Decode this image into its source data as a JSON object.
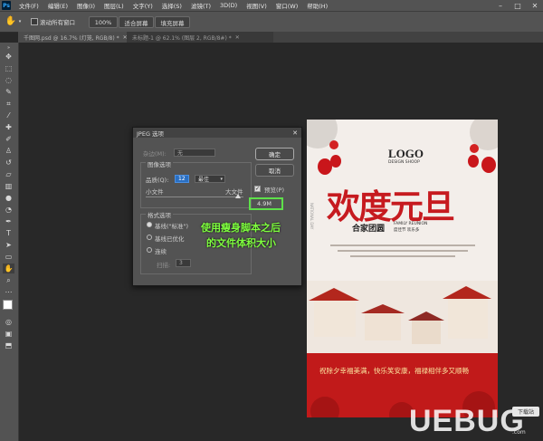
{
  "app": {
    "logo": "Ps"
  },
  "menu": [
    "文件(F)",
    "编辑(E)",
    "图像(I)",
    "图层(L)",
    "文字(Y)",
    "选择(S)",
    "滤镜(T)",
    "3D(D)",
    "视图(V)",
    "窗口(W)",
    "帮助(H)"
  ],
  "options_bar": {
    "scroll_all_windows": "滚动所有窗口",
    "zoom_100": "100%",
    "fit_screen": "适合屏幕",
    "fill_screen": "填充屏幕"
  },
  "tabs": [
    {
      "label": "千图网.psd @ 16.7% (灯笼, RGB/8) *",
      "active": false
    },
    {
      "label": "未标题-1 @ 62.1% (图层 2, RGB/8#) *",
      "active": true
    }
  ],
  "dialog": {
    "title": "JPEG 选项",
    "matte_label": "杂边(M):",
    "matte_value": "无",
    "image_options": "图像选项",
    "quality_label": "品质(Q):",
    "quality_value": "12",
    "quality_preset": "最佳",
    "small_file": "小文件",
    "large_file": "大文件",
    "format_options": "格式选项",
    "format_baseline": "基线(\"标准\")",
    "format_optimized": "基线已优化",
    "format_progressive": "连续",
    "scans_label": "扫描:",
    "scans_value": "3",
    "ok": "确定",
    "cancel": "取消",
    "preview": "预览(P)",
    "file_size": "4.9M"
  },
  "annotation": {
    "line1": "使用瘦身脚本之后",
    "line2": "的文件体积大小",
    "color": "#7fff3f"
  },
  "poster": {
    "logo": "LOGO",
    "logo_sub": "DESIGN SHOOP",
    "title": "欢度元旦",
    "subtitle": "合家团圆",
    "subtitle_en": "FAMILY REUNION",
    "subtitle_en2": "度佳节 欢乐多",
    "side_text": "NATIONAL DAY",
    "banner_text": "祝除夕幸福美满，快乐笑安康，福禄相伴多又顺畅",
    "accent": "#c11a1a"
  },
  "watermark": {
    "text": "UEBUG",
    "suffix": ".com",
    "tag": "下载站"
  }
}
